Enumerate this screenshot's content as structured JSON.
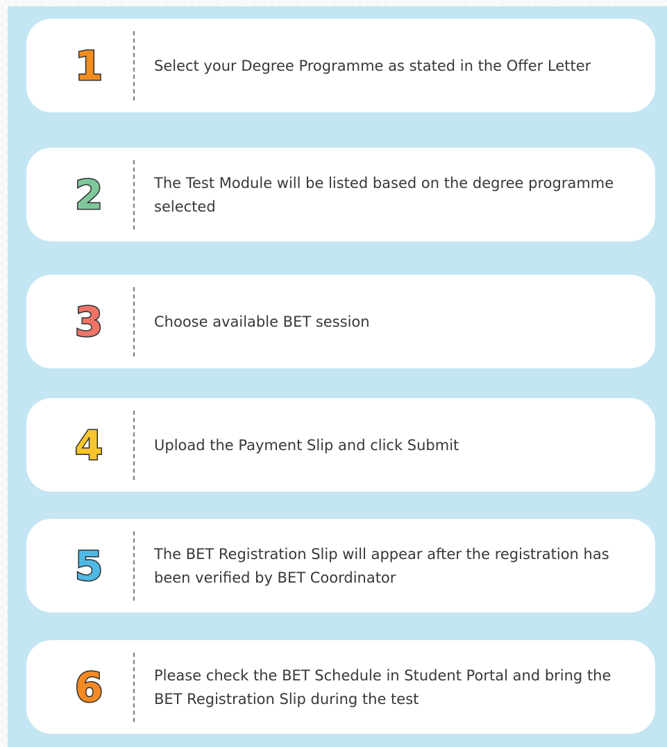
{
  "steps": [
    {
      "number": "1",
      "color": "#f28c1e",
      "text": "Select your Degree Programme as stated in the Offer Letter"
    },
    {
      "number": "2",
      "color": "#7fc79a",
      "text": "The Test Module will be listed based on the degree programme selected"
    },
    {
      "number": "3",
      "color": "#ef7468",
      "text": "Choose available BET session"
    },
    {
      "number": "4",
      "color": "#f7c52e",
      "text": "Upload the Payment Slip and click Submit"
    },
    {
      "number": "5",
      "color": "#4fb9e6",
      "text": "The BET Registration Slip will appear after the registration has been verified by BET Coordinator"
    },
    {
      "number": "6",
      "color": "#f58a23",
      "text": "Please check the BET Schedule in Student Portal and bring the BET Registration Slip during the test"
    }
  ]
}
